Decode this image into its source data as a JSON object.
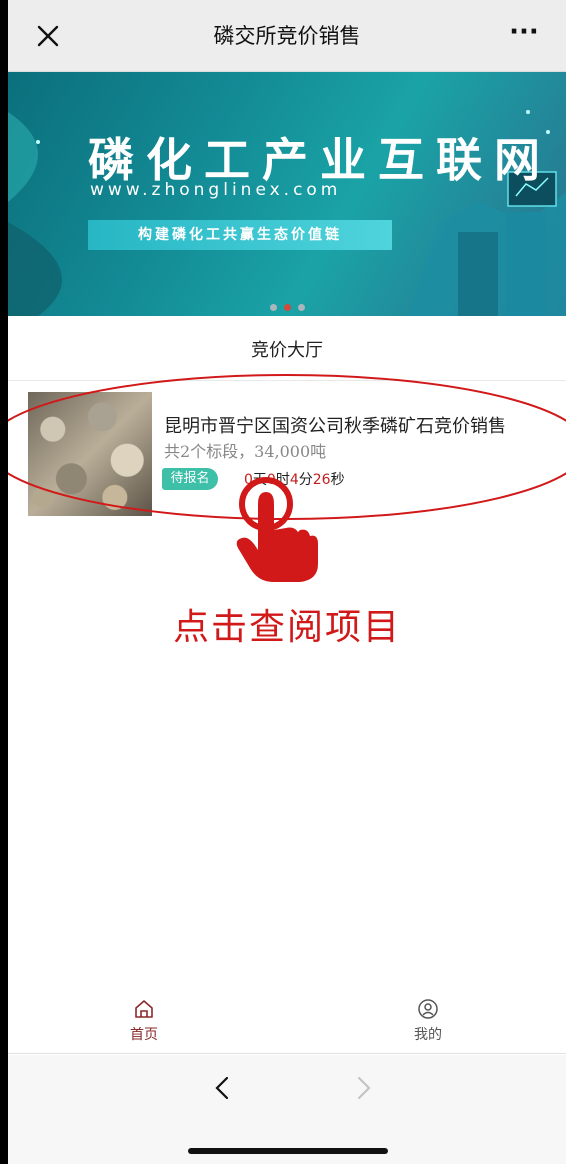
{
  "navbar": {
    "title": "磷交所竞价销售",
    "close_icon": "close-icon",
    "more_label": "···"
  },
  "banner": {
    "title": "磷化工产业互联网",
    "url": "www.zhonglinex.com",
    "slogan": "构建磷化工共赢生态价值链",
    "active_dot": 2,
    "dot_count": 3
  },
  "section": {
    "title": "竞价大厅"
  },
  "listing": {
    "title": "昆明市晋宁区国资公司秋季磷矿石竞价销售",
    "subtitle": "共2个标段，34,000吨",
    "status": "待报名",
    "countdown": {
      "days": "0",
      "days_unit": "天",
      "hours": "0",
      "hours_unit": "时",
      "minutes": "4",
      "minutes_unit": "分",
      "seconds": "26",
      "seconds_unit": "秒"
    }
  },
  "annotation": {
    "text": "点击查阅项目",
    "color": "#d11919"
  },
  "tabbar": {
    "home_label": "首页",
    "me_label": "我的",
    "active": "home"
  },
  "colors": {
    "accent_badge": "#3dbfa8",
    "countdown_number": "#c21f1f",
    "active_tab": "#8b2a2a"
  }
}
